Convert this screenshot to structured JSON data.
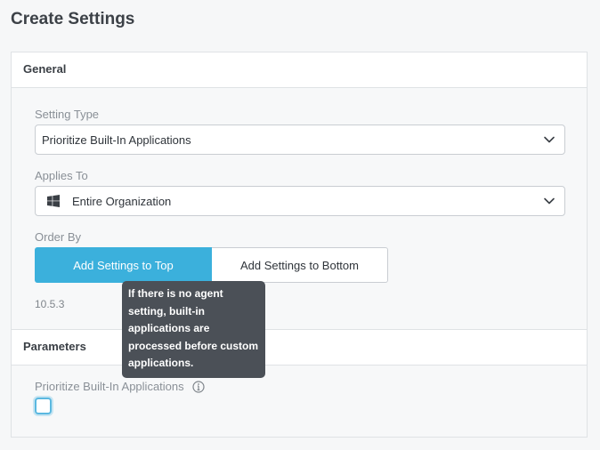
{
  "page": {
    "title": "Create Settings"
  },
  "general": {
    "header": "General",
    "setting_type": {
      "label": "Setting Type",
      "value": "Prioritize Built-In Applications"
    },
    "applies_to": {
      "label": "Applies To",
      "value": "Entire Organization",
      "icon": "windows-icon"
    },
    "order_by": {
      "label": "Order By",
      "options": [
        "Add Settings to Top",
        "Add Settings to Bottom"
      ],
      "selected": "Add Settings to Top"
    },
    "version": "10.5.3"
  },
  "parameters": {
    "header": "Parameters",
    "checkbox_label": "Prioritize Built-In Applications",
    "checked": false
  },
  "tooltip": {
    "text": "If there is no agent setting, built-in applications are processed before custom applications."
  },
  "colors": {
    "accent": "#3bb0dc",
    "tooltip_bg": "#4b5057"
  }
}
